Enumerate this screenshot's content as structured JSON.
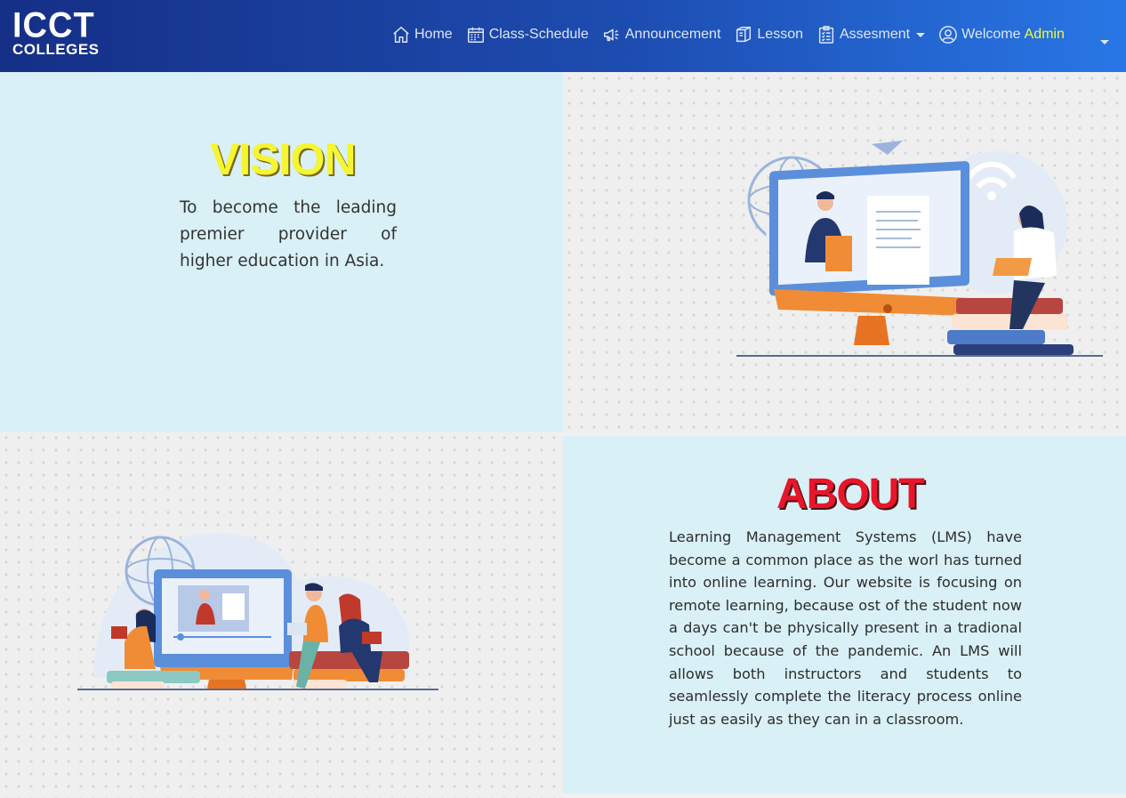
{
  "brand": {
    "line1": "ICCT",
    "line2": "COLLEGES"
  },
  "nav": {
    "home": "Home",
    "schedule": "Class-Schedule",
    "announcement": "Announcement",
    "lesson": "Lesson",
    "assessment": "Assesment",
    "welcome": "Welcome",
    "user": "Admin"
  },
  "vision": {
    "title": "VISION",
    "text": "To become the leading premier provider of higher education in Asia."
  },
  "about": {
    "title": "ABOUT",
    "text": "Learning Management Systems (LMS) have become a common place as the worl has turned into online learning. Our website is focusing on remote learning, because ost of the student now a days can't be physically present in a tradional school because of the pandemic. An LMS will allows both instructors and students to seamlessly complete the literacy process online just as easily as they can in a classroom."
  },
  "icons": [
    "home-icon",
    "calendar-icon",
    "megaphone-icon",
    "book-icon",
    "checklist-icon",
    "user-circle-icon",
    "caret-down-icon"
  ],
  "colors": {
    "nav_start": "#152f86",
    "nav_end": "#2877e6",
    "vision_title": "#f5f532",
    "about_title": "#e8152b",
    "panel": "#d9f0f6"
  }
}
